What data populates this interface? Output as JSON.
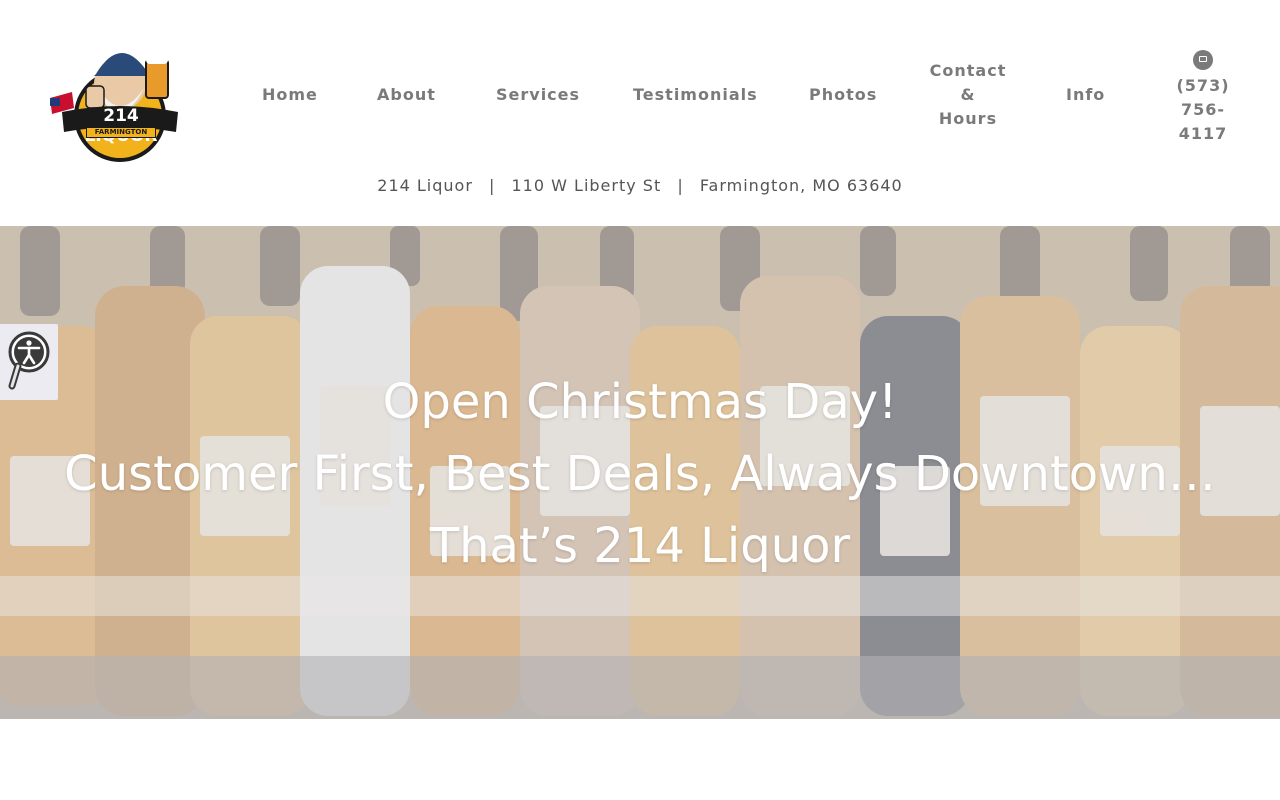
{
  "header": {
    "logo": {
      "text_main": "214 LIQUOR",
      "text_sub": "FARMINGTON",
      "icon": "mascot-logo-icon"
    },
    "nav": [
      {
        "label": "Home"
      },
      {
        "label": "About"
      },
      {
        "label": "Services"
      },
      {
        "label": "Testimonials"
      },
      {
        "label": "Photos"
      },
      {
        "label": "Contact\n&\nHours",
        "line1": "Contact",
        "line2": "&",
        "line3": "Hours"
      },
      {
        "label": "Info"
      }
    ],
    "phone": {
      "icon": "phone-icon",
      "line1": "(573)",
      "line2": "756-",
      "line3": "4117"
    },
    "address": {
      "name": "214 Liquor",
      "sep": "|",
      "street": "110 W Liberty St",
      "city": "Farmington, MO 63640"
    }
  },
  "hero": {
    "line1": "Open Christmas Day!",
    "line2": "Customer First, Best Deals, Always Downtown…",
    "line3": "That’s 214 Liquor"
  },
  "accessibility": {
    "icon": "accessibility-icon"
  },
  "colors": {
    "nav_text": "#7a7a7a",
    "address_text": "#555555",
    "hero_text": "#ffffff",
    "widget_bg": "#ecebf2"
  }
}
